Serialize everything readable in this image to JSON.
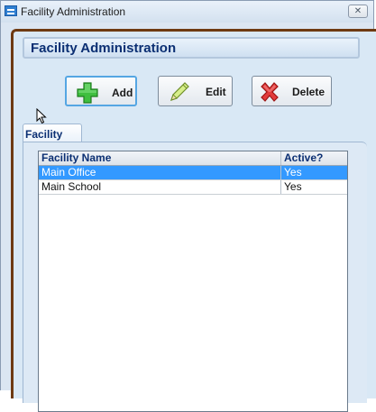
{
  "window": {
    "title": "Facility Administration",
    "close_glyph": "✕",
    "icon": "app-window-icon"
  },
  "header": {
    "title": "Facility Administration"
  },
  "toolbar": {
    "add_label": "Add",
    "edit_label": "Edit",
    "delete_label": "Delete",
    "add_icon": "green-plus-icon",
    "edit_icon": "pencil-icon",
    "delete_icon": "red-x-icon"
  },
  "tabs": [
    {
      "label": "Facility",
      "active": true
    }
  ],
  "grid": {
    "columns": [
      "Facility Name",
      "Active?"
    ],
    "rows": [
      {
        "name": "Main Office",
        "active": "Yes",
        "selected": true
      },
      {
        "name": "Main School",
        "active": "Yes",
        "selected": false
      }
    ]
  },
  "colors": {
    "accent_border": "#6e3a12",
    "selection": "#3399ff",
    "header_text": "#0b2f73"
  }
}
